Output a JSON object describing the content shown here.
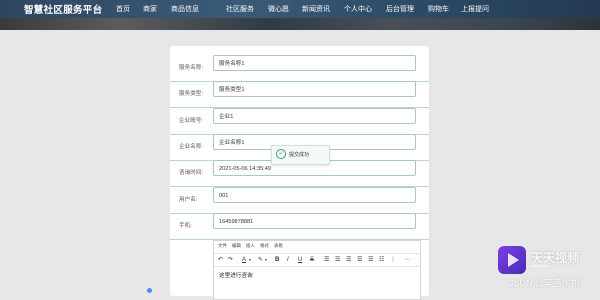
{
  "header": {
    "title": "智慧社区服务平台",
    "nav": [
      {
        "label": "首页"
      },
      {
        "label": "商家"
      },
      {
        "label": "商品信息"
      },
      {
        "label": "社区服务"
      },
      {
        "label": "微心愿"
      },
      {
        "label": "新闻资讯"
      },
      {
        "label": "个人中心"
      },
      {
        "label": "后台管理"
      },
      {
        "label": "购物车"
      },
      {
        "label": "上报提问"
      }
    ]
  },
  "form": {
    "fields": [
      {
        "label": "服务名称:",
        "value": "服务名称1"
      },
      {
        "label": "服务类型:",
        "value": "服务类型1"
      },
      {
        "label": "企业账号:",
        "value": "企业1"
      },
      {
        "label": "企业名称:",
        "value": "企业名称1"
      },
      {
        "label": "咨询时间:",
        "value": "2021-05-06 14:35:49"
      },
      {
        "label": "用户名:",
        "value": "001"
      },
      {
        "label": "手机:",
        "value": "16459878881"
      }
    ]
  },
  "editor": {
    "menus": [
      "文件",
      "编辑",
      "插入",
      "格式",
      "表格"
    ],
    "toolbar": [
      "↶",
      "↷",
      "A",
      "▾",
      "✎",
      "▾",
      "B",
      "I",
      "U",
      "S",
      "☰",
      "☰",
      "☰",
      "☰",
      "☰",
      "☷",
      "⋮",
      "⋯"
    ],
    "content": "这里进行咨询"
  },
  "toast": {
    "icon": "check-circle-icon",
    "text": "提交成功",
    "color": "#3aa176"
  },
  "watermark": {
    "app": "天天视频",
    "app_sub": "Windows",
    "csdn": "CSDN @辛苦学姐"
  },
  "colors": {
    "accent": "#3aa176",
    "field_border": "#aac8bf",
    "topbar": "#2f4660"
  }
}
